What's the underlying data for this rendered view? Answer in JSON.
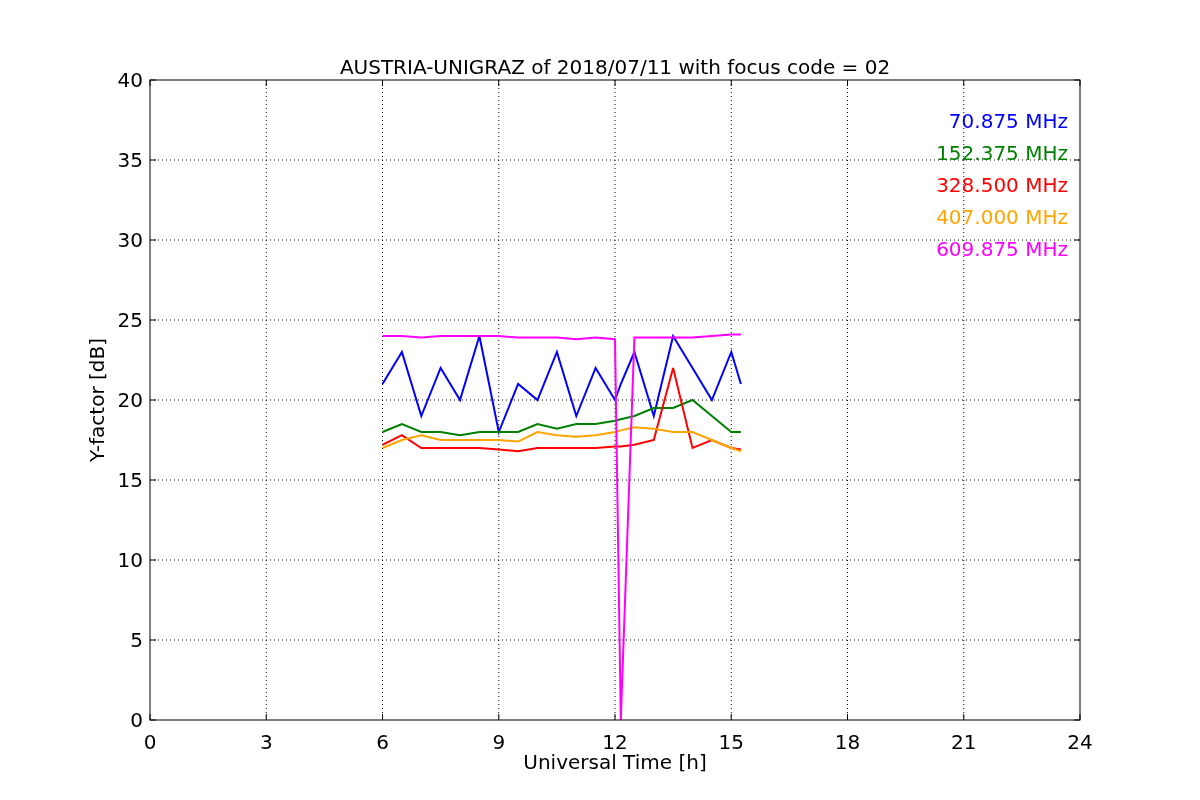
{
  "plot": {
    "chart_data": {
      "type": "line",
      "title": "AUSTRIA-UNIGRAZ of 2018/07/11 with focus code = 02",
      "xlabel": "Universal Time [h]",
      "ylabel": "Y-factor [dB]",
      "x": [
        6,
        6.5,
        7,
        7.5,
        8,
        8.5,
        9,
        9.5,
        10,
        10.5,
        11,
        11.5,
        12,
        12.15,
        12.5,
        13,
        13.5,
        14,
        14.5,
        15,
        15.25
      ],
      "series": [
        {
          "name": "70.875 MHz",
          "color": "#0000ff",
          "values": [
            21,
            23,
            19,
            22,
            20,
            24,
            18,
            21,
            20,
            23,
            19,
            22,
            20,
            21,
            23,
            19,
            24,
            22,
            20,
            23,
            21
          ]
        },
        {
          "name": "152.375 MHz",
          "color": "#008000",
          "values": [
            18,
            18.5,
            18,
            18,
            17.8,
            18,
            18,
            18,
            18.5,
            18.2,
            18.5,
            18.5,
            18.7,
            18.8,
            19,
            19.5,
            19.5,
            20,
            19,
            18,
            18
          ]
        },
        {
          "name": "328.500 MHz",
          "color": "#ff0000",
          "values": [
            17.2,
            17.8,
            17,
            17,
            17,
            17,
            16.9,
            16.8,
            17,
            17,
            17,
            17,
            17.1,
            17.1,
            17.2,
            17.5,
            22,
            17,
            17.5,
            17,
            16.9
          ]
        },
        {
          "name": "407.000 MHz",
          "color": "#ffa500",
          "values": [
            17,
            17.5,
            17.8,
            17.5,
            17.5,
            17.5,
            17.5,
            17.4,
            18,
            17.8,
            17.7,
            17.8,
            18,
            18.1,
            18.3,
            18.2,
            18,
            18,
            17.5,
            17,
            16.8
          ]
        },
        {
          "name": "609.875 MHz",
          "color": "#ff00ff",
          "values": [
            24,
            24,
            23.9,
            24,
            24,
            24,
            24,
            23.9,
            23.9,
            23.9,
            23.8,
            23.9,
            23.8,
            0,
            23.9,
            23.9,
            23.9,
            23.9,
            24,
            24.1,
            24.1
          ]
        }
      ],
      "grid": true,
      "xlim": [
        0,
        24
      ],
      "ylim": [
        0,
        40
      ],
      "xticks": [
        0,
        3,
        6,
        9,
        12,
        15,
        18,
        21,
        24
      ],
      "yticks": [
        0,
        5,
        10,
        15,
        20,
        25,
        30,
        35,
        40
      ]
    }
  }
}
